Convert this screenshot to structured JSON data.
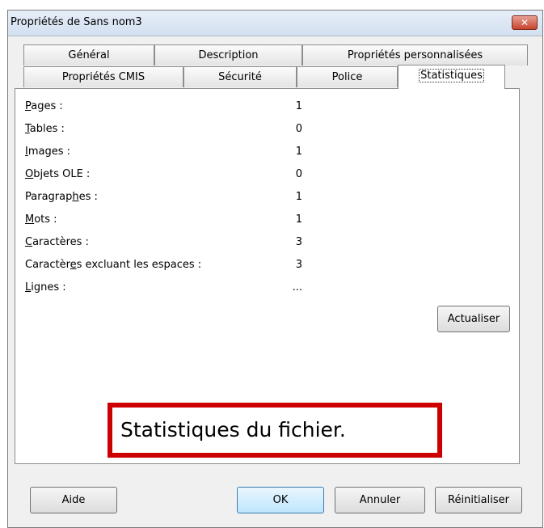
{
  "window": {
    "title": "Propriétés de Sans nom3",
    "close_label": "✕"
  },
  "tabs": {
    "row1": [
      "Général",
      "Description",
      "Propriétés personnalisées"
    ],
    "row2": [
      "Propriétés CMIS",
      "Sécurité",
      "Police",
      "Statistiques"
    ],
    "active": "Statistiques"
  },
  "stats": [
    {
      "label": "Pages :",
      "value": "1",
      "accel": "P"
    },
    {
      "label": "Tables :",
      "value": "0",
      "accel": "T"
    },
    {
      "label": "Images :",
      "value": "1",
      "accel": "I"
    },
    {
      "label": "Objets OLE :",
      "value": "0",
      "accel": "O"
    },
    {
      "label": "Paragraphes :",
      "value": "1",
      "accel": "h"
    },
    {
      "label": "Mots :",
      "value": "1",
      "accel": "M"
    },
    {
      "label": "Caractères :",
      "value": "3",
      "accel": "C"
    },
    {
      "label": "Caractères excluant les espaces :",
      "value": "3",
      "accel": "e"
    },
    {
      "label": "Lignes :",
      "value": "...",
      "accel": "L"
    }
  ],
  "buttons": {
    "refresh": "Actualiser",
    "help": "Aide",
    "ok": "OK",
    "cancel": "Annuler",
    "reset": "Réinitialiser"
  },
  "callout": "Statistiques du fichier.",
  "colors": {
    "callout_border": "#cc0000",
    "close_button": "#c7432d",
    "default_button": "#bee6fd"
  }
}
